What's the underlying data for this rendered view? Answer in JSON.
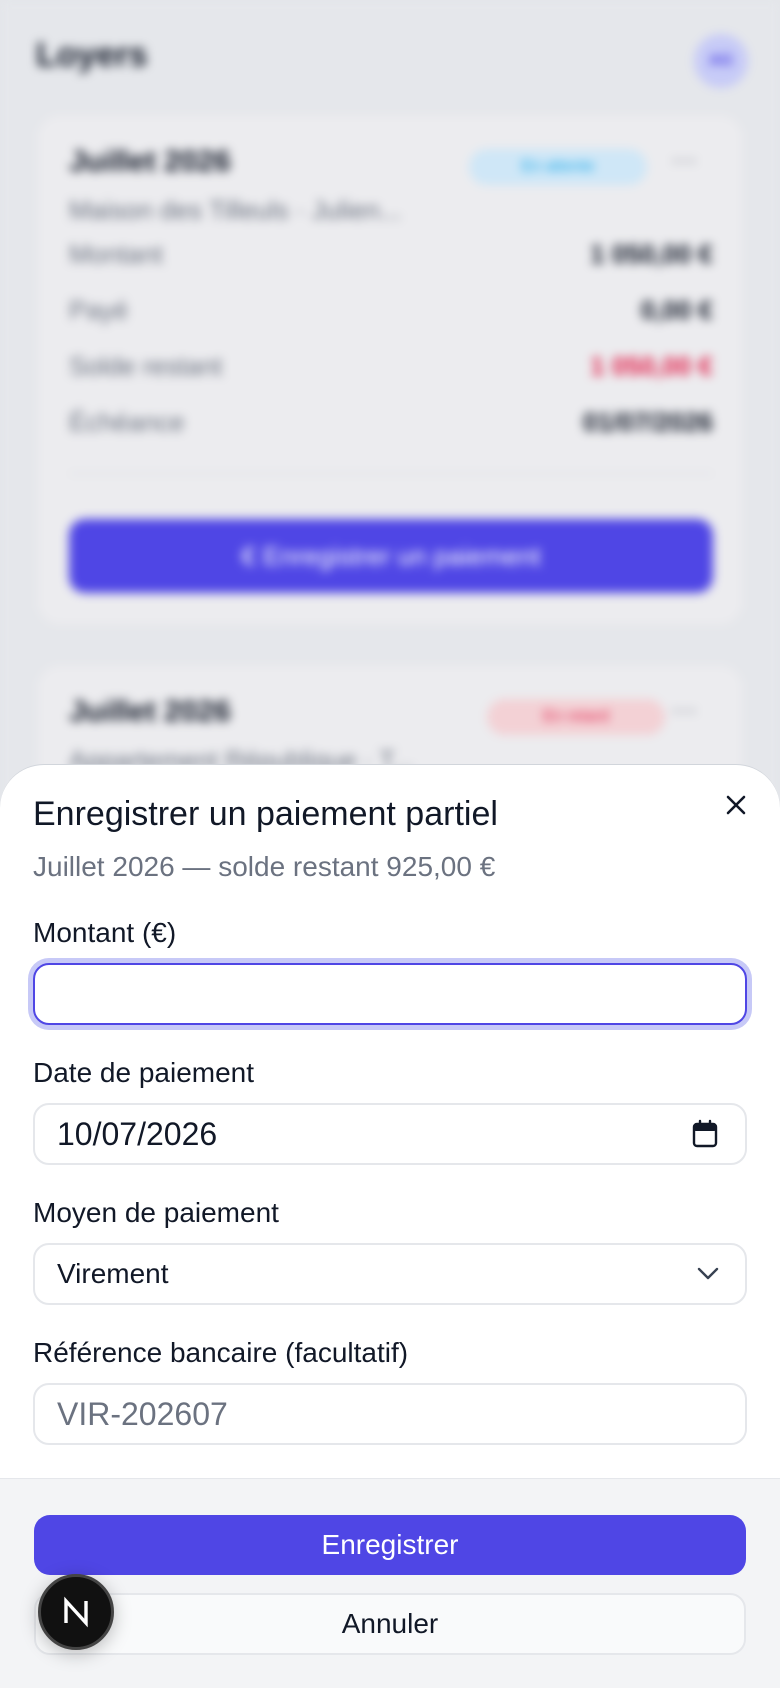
{
  "background": {
    "page_title": "Loyers",
    "avatar_initials": "AG",
    "cards": [
      {
        "title": "Juillet 2026",
        "subtitle": "Maison des Tilleuls · Julien...",
        "badge": "En attente",
        "badge_color": "#0ea5e9",
        "rows": [
          {
            "label": "Montant",
            "value": "1 050,00 €"
          },
          {
            "label": "Payé",
            "value": "0,00 €"
          },
          {
            "label": "Solde restant",
            "value": "1 050,00 €"
          },
          {
            "label": "Échéance",
            "value": "01/07/2026"
          }
        ],
        "action_label": "€  Enregistrer un paiement"
      },
      {
        "title": "Juillet 2026",
        "subtitle": "Appartement République · T...",
        "badge": "En retard",
        "badge_color": "#e11d48"
      }
    ]
  },
  "sheet": {
    "title": "Enregistrer un paiement partiel",
    "subtitle": "Juillet 2026 — solde restant 925,00 €",
    "fields": {
      "amount": {
        "label": "Montant (€)",
        "value": "",
        "placeholder": ""
      },
      "date": {
        "label": "Date de paiement",
        "value": "10/07/2026",
        "icon": "calendar-icon"
      },
      "method": {
        "label": "Moyen de paiement",
        "selected": "Virement",
        "icon": "chevron-down-icon"
      },
      "reference": {
        "label": "Référence bancaire (facultatif)",
        "placeholder": "VIR-202607"
      }
    },
    "close_icon": "close-icon",
    "submit_label": "Enregistrer",
    "cancel_label": "Annuler"
  },
  "dev_badge": {
    "letter": "N"
  },
  "colors": {
    "accent": "#4f46e5",
    "focus_ring": "#c7c9f7",
    "text_primary": "#111827",
    "text_muted": "#6b7280",
    "border": "#e5e7eb"
  }
}
